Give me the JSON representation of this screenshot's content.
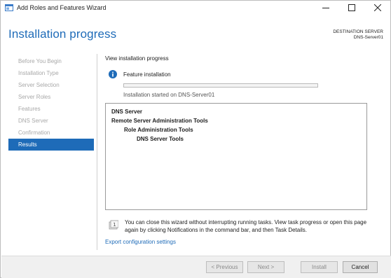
{
  "window": {
    "title": "Add Roles and Features Wizard"
  },
  "header": {
    "page_title": "Installation progress",
    "destination_label": "DESTINATION SERVER",
    "destination_server": "DNS-Server01"
  },
  "nav": {
    "items": [
      {
        "label": "Before You Begin",
        "active": false
      },
      {
        "label": "Installation Type",
        "active": false
      },
      {
        "label": "Server Selection",
        "active": false
      },
      {
        "label": "Server Roles",
        "active": false
      },
      {
        "label": "Features",
        "active": false
      },
      {
        "label": "DNS Server",
        "active": false
      },
      {
        "label": "Confirmation",
        "active": false
      },
      {
        "label": "Results",
        "active": true
      }
    ]
  },
  "content": {
    "heading": "View installation progress",
    "feature_label": "Feature installation",
    "progress_percent": 0,
    "started_text": "Installation started on DNS-Server01",
    "results": [
      {
        "label": "DNS Server",
        "level": 0
      },
      {
        "label": "Remote Server Administration Tools",
        "level": 0
      },
      {
        "label": "Role Administration Tools",
        "level": 1
      },
      {
        "label": "DNS Server Tools",
        "level": 2
      }
    ],
    "notice": "You can close this wizard without interrupting running tasks. View task progress or open this page again by clicking Notifications in the command bar, and then Task Details.",
    "export_link": "Export configuration settings"
  },
  "footer": {
    "previous": "< Previous",
    "next": "Next >",
    "install": "Install",
    "cancel": "Cancel"
  },
  "colors": {
    "accent": "#1e6bb8",
    "progress": "#3c8dde"
  }
}
